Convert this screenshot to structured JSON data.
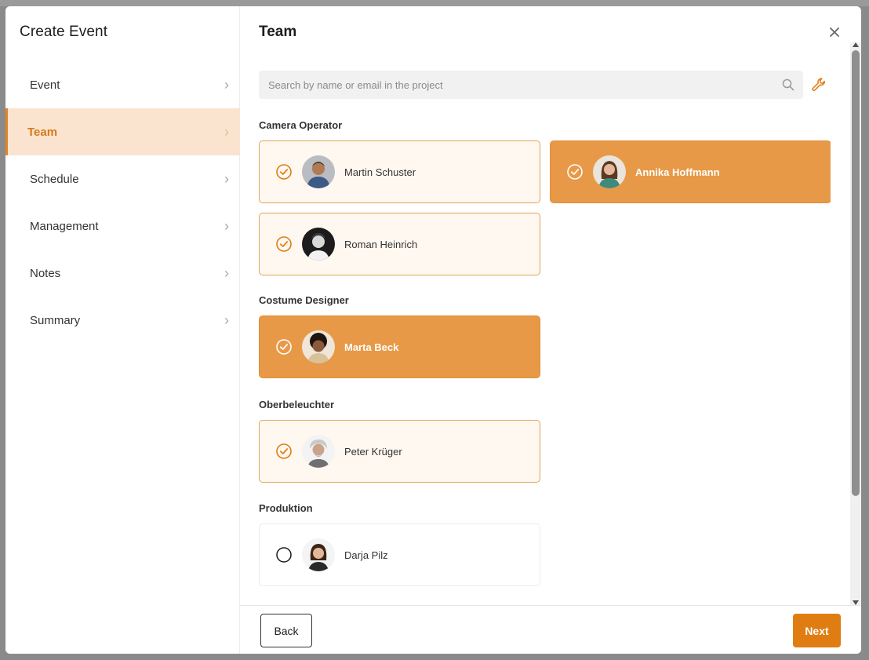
{
  "sidebar": {
    "title": "Create Event",
    "items": [
      {
        "label": "Event",
        "active": false
      },
      {
        "label": "Team",
        "active": true
      },
      {
        "label": "Schedule",
        "active": false
      },
      {
        "label": "Management",
        "active": false
      },
      {
        "label": "Notes",
        "active": false
      },
      {
        "label": "Summary",
        "active": false
      }
    ]
  },
  "main": {
    "title": "Team",
    "search_placeholder": "Search by name or email in the project",
    "groups": [
      {
        "label": "Camera Operator",
        "members": [
          {
            "name": "Martin Schuster",
            "selected": true,
            "highlighted": false
          },
          {
            "name": "Annika Hoffmann",
            "selected": true,
            "highlighted": true
          },
          {
            "name": "Roman Heinrich",
            "selected": true,
            "highlighted": false
          }
        ]
      },
      {
        "label": "Costume Designer",
        "members": [
          {
            "name": "Marta Beck",
            "selected": true,
            "highlighted": true
          }
        ]
      },
      {
        "label": "Oberbeleuchter",
        "members": [
          {
            "name": "Peter Krüger",
            "selected": true,
            "highlighted": false
          }
        ]
      },
      {
        "label": "Produktion",
        "members": [
          {
            "name": "Darja Pilz",
            "selected": false,
            "highlighted": false
          }
        ]
      }
    ]
  },
  "footer": {
    "back_label": "Back",
    "next_label": "Next"
  },
  "colors": {
    "accent": "#e07d12",
    "highlight_card": "#e89947",
    "selected_card_bg": "#fff8f0",
    "active_nav_bg": "#fae4cf"
  }
}
